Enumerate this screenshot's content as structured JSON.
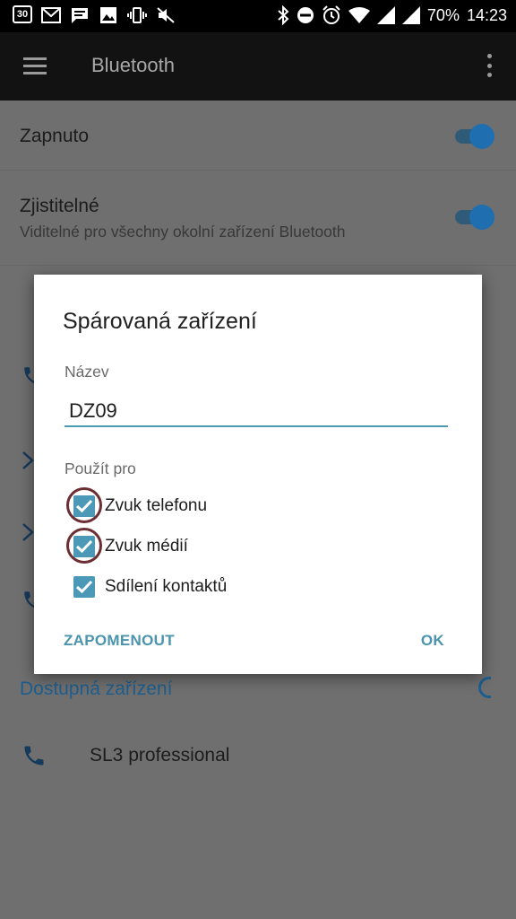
{
  "status_bar": {
    "calendar_day": "30",
    "battery": "70%",
    "time": "14:23",
    "icons": [
      "calendar-icon",
      "gmail-icon",
      "message-icon",
      "image-icon",
      "vibrate-icon",
      "mute-icon",
      "bluetooth-icon",
      "dnd-icon",
      "alarm-icon",
      "wifi-icon",
      "signal-icon",
      "signal-icon"
    ]
  },
  "app_bar": {
    "title": "Bluetooth"
  },
  "settings": {
    "enabled_label": "Zapnuto",
    "discoverable_label": "Zjistitelné",
    "discoverable_desc": "Viditelné pro všechny okolní zařízení Bluetooth",
    "enabled_on": true,
    "discoverable_on": true
  },
  "available": {
    "section_label": "Dostupná zařízení",
    "devices": [
      {
        "name": "SL3 professional",
        "icon": "phone-icon"
      }
    ]
  },
  "dialog": {
    "title": "Spárovaná zařízení",
    "name_label": "Název",
    "name_value": "DZ09",
    "use_label": "Použít pro",
    "options": [
      {
        "label": "Zvuk telefonu",
        "checked": true
      },
      {
        "label": "Zvuk médií",
        "checked": true
      },
      {
        "label": "Sdílení kontaktů",
        "checked": true
      }
    ],
    "forget_button": "ZAPOMENOUT",
    "ok_button": "OK"
  },
  "colors": {
    "accent": "#4c99b7",
    "toggle_thumb": "#1f6fb0",
    "section_label": "#1e5e8e",
    "highlight_ring": "#6b2e33"
  }
}
